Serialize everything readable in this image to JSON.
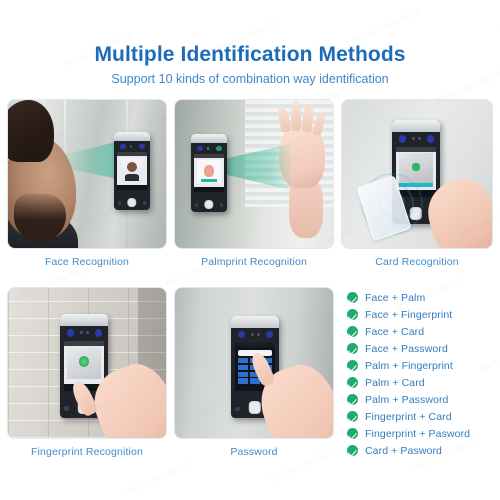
{
  "header": {
    "title": "Multiple Identification Methods",
    "subtitle": "Support 10 kinds of combination way identification",
    "title_color": "#1c6cba",
    "subtitle_color": "#3d87c9"
  },
  "panels": [
    {
      "caption": "Face Recognition",
      "scene": "face-scene",
      "beam_color": "#1eb48c"
    },
    {
      "caption": "Palmprint Recognition",
      "scene": "palmprint-scene",
      "beam_color": "#1eb48c"
    },
    {
      "caption": "Card Recognition",
      "scene": "card-scene",
      "wave_color": "#4296dc"
    },
    {
      "caption": "Fingerprint Recognition",
      "scene": "fingerprint-scene",
      "accent_color": "#3fc06a"
    },
    {
      "caption": "Password",
      "scene": "password-scene",
      "keypad_color": "#2f6fd0"
    }
  ],
  "combinations": {
    "check_color": "#1faa6f",
    "text_color": "#2f7cc0",
    "items": [
      "Face + Palm",
      "Face + Fingerprint",
      "Face + Card",
      "Face + Password",
      "Palm + Fingerprint",
      "Palm + Card",
      "Palm + Password",
      "Fingerprint + Card",
      "Fingerprint + Pasword",
      "Card + Pasword"
    ]
  },
  "watermark": {
    "text": "深圳市xx科技有限公司",
    "repeat": 26
  }
}
